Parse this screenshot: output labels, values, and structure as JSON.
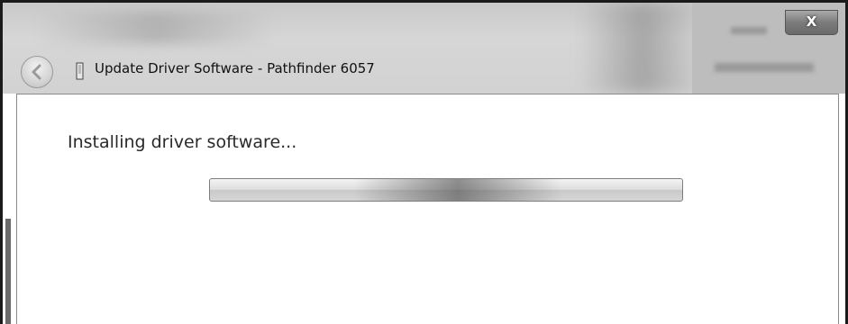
{
  "window": {
    "title": "Update Driver Software - Pathfinder 6057",
    "close_label": "X"
  },
  "content": {
    "heading": "Installing driver software..."
  },
  "progress": {
    "indeterminate": true
  }
}
